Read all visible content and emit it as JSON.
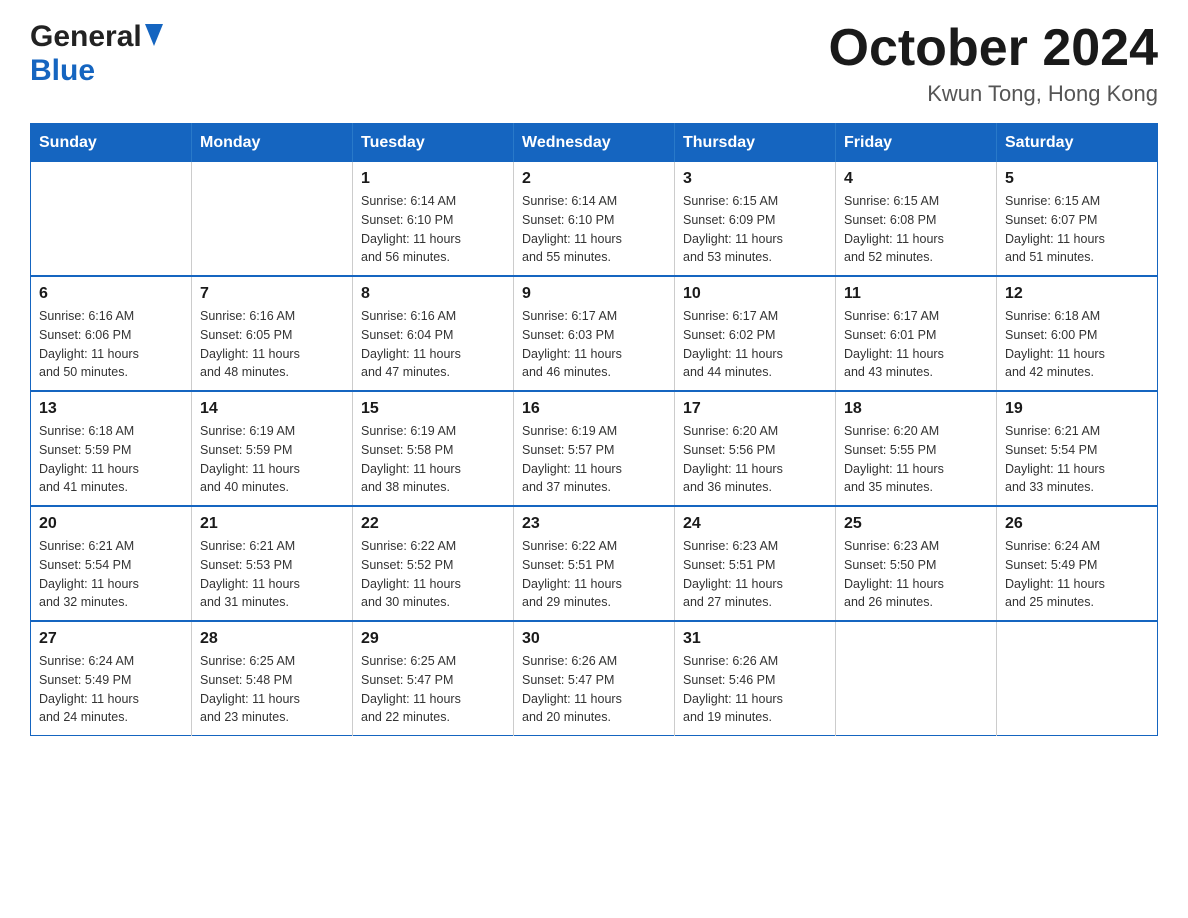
{
  "header": {
    "logo_general": "General",
    "logo_blue": "Blue",
    "month_title": "October 2024",
    "location": "Kwun Tong, Hong Kong"
  },
  "calendar": {
    "days_of_week": [
      "Sunday",
      "Monday",
      "Tuesday",
      "Wednesday",
      "Thursday",
      "Friday",
      "Saturday"
    ],
    "weeks": [
      [
        {
          "day": "",
          "info": ""
        },
        {
          "day": "",
          "info": ""
        },
        {
          "day": "1",
          "info": "Sunrise: 6:14 AM\nSunset: 6:10 PM\nDaylight: 11 hours\nand 56 minutes."
        },
        {
          "day": "2",
          "info": "Sunrise: 6:14 AM\nSunset: 6:10 PM\nDaylight: 11 hours\nand 55 minutes."
        },
        {
          "day": "3",
          "info": "Sunrise: 6:15 AM\nSunset: 6:09 PM\nDaylight: 11 hours\nand 53 minutes."
        },
        {
          "day": "4",
          "info": "Sunrise: 6:15 AM\nSunset: 6:08 PM\nDaylight: 11 hours\nand 52 minutes."
        },
        {
          "day": "5",
          "info": "Sunrise: 6:15 AM\nSunset: 6:07 PM\nDaylight: 11 hours\nand 51 minutes."
        }
      ],
      [
        {
          "day": "6",
          "info": "Sunrise: 6:16 AM\nSunset: 6:06 PM\nDaylight: 11 hours\nand 50 minutes."
        },
        {
          "day": "7",
          "info": "Sunrise: 6:16 AM\nSunset: 6:05 PM\nDaylight: 11 hours\nand 48 minutes."
        },
        {
          "day": "8",
          "info": "Sunrise: 6:16 AM\nSunset: 6:04 PM\nDaylight: 11 hours\nand 47 minutes."
        },
        {
          "day": "9",
          "info": "Sunrise: 6:17 AM\nSunset: 6:03 PM\nDaylight: 11 hours\nand 46 minutes."
        },
        {
          "day": "10",
          "info": "Sunrise: 6:17 AM\nSunset: 6:02 PM\nDaylight: 11 hours\nand 44 minutes."
        },
        {
          "day": "11",
          "info": "Sunrise: 6:17 AM\nSunset: 6:01 PM\nDaylight: 11 hours\nand 43 minutes."
        },
        {
          "day": "12",
          "info": "Sunrise: 6:18 AM\nSunset: 6:00 PM\nDaylight: 11 hours\nand 42 minutes."
        }
      ],
      [
        {
          "day": "13",
          "info": "Sunrise: 6:18 AM\nSunset: 5:59 PM\nDaylight: 11 hours\nand 41 minutes."
        },
        {
          "day": "14",
          "info": "Sunrise: 6:19 AM\nSunset: 5:59 PM\nDaylight: 11 hours\nand 40 minutes."
        },
        {
          "day": "15",
          "info": "Sunrise: 6:19 AM\nSunset: 5:58 PM\nDaylight: 11 hours\nand 38 minutes."
        },
        {
          "day": "16",
          "info": "Sunrise: 6:19 AM\nSunset: 5:57 PM\nDaylight: 11 hours\nand 37 minutes."
        },
        {
          "day": "17",
          "info": "Sunrise: 6:20 AM\nSunset: 5:56 PM\nDaylight: 11 hours\nand 36 minutes."
        },
        {
          "day": "18",
          "info": "Sunrise: 6:20 AM\nSunset: 5:55 PM\nDaylight: 11 hours\nand 35 minutes."
        },
        {
          "day": "19",
          "info": "Sunrise: 6:21 AM\nSunset: 5:54 PM\nDaylight: 11 hours\nand 33 minutes."
        }
      ],
      [
        {
          "day": "20",
          "info": "Sunrise: 6:21 AM\nSunset: 5:54 PM\nDaylight: 11 hours\nand 32 minutes."
        },
        {
          "day": "21",
          "info": "Sunrise: 6:21 AM\nSunset: 5:53 PM\nDaylight: 11 hours\nand 31 minutes."
        },
        {
          "day": "22",
          "info": "Sunrise: 6:22 AM\nSunset: 5:52 PM\nDaylight: 11 hours\nand 30 minutes."
        },
        {
          "day": "23",
          "info": "Sunrise: 6:22 AM\nSunset: 5:51 PM\nDaylight: 11 hours\nand 29 minutes."
        },
        {
          "day": "24",
          "info": "Sunrise: 6:23 AM\nSunset: 5:51 PM\nDaylight: 11 hours\nand 27 minutes."
        },
        {
          "day": "25",
          "info": "Sunrise: 6:23 AM\nSunset: 5:50 PM\nDaylight: 11 hours\nand 26 minutes."
        },
        {
          "day": "26",
          "info": "Sunrise: 6:24 AM\nSunset: 5:49 PM\nDaylight: 11 hours\nand 25 minutes."
        }
      ],
      [
        {
          "day": "27",
          "info": "Sunrise: 6:24 AM\nSunset: 5:49 PM\nDaylight: 11 hours\nand 24 minutes."
        },
        {
          "day": "28",
          "info": "Sunrise: 6:25 AM\nSunset: 5:48 PM\nDaylight: 11 hours\nand 23 minutes."
        },
        {
          "day": "29",
          "info": "Sunrise: 6:25 AM\nSunset: 5:47 PM\nDaylight: 11 hours\nand 22 minutes."
        },
        {
          "day": "30",
          "info": "Sunrise: 6:26 AM\nSunset: 5:47 PM\nDaylight: 11 hours\nand 20 minutes."
        },
        {
          "day": "31",
          "info": "Sunrise: 6:26 AM\nSunset: 5:46 PM\nDaylight: 11 hours\nand 19 minutes."
        },
        {
          "day": "",
          "info": ""
        },
        {
          "day": "",
          "info": ""
        }
      ]
    ]
  }
}
